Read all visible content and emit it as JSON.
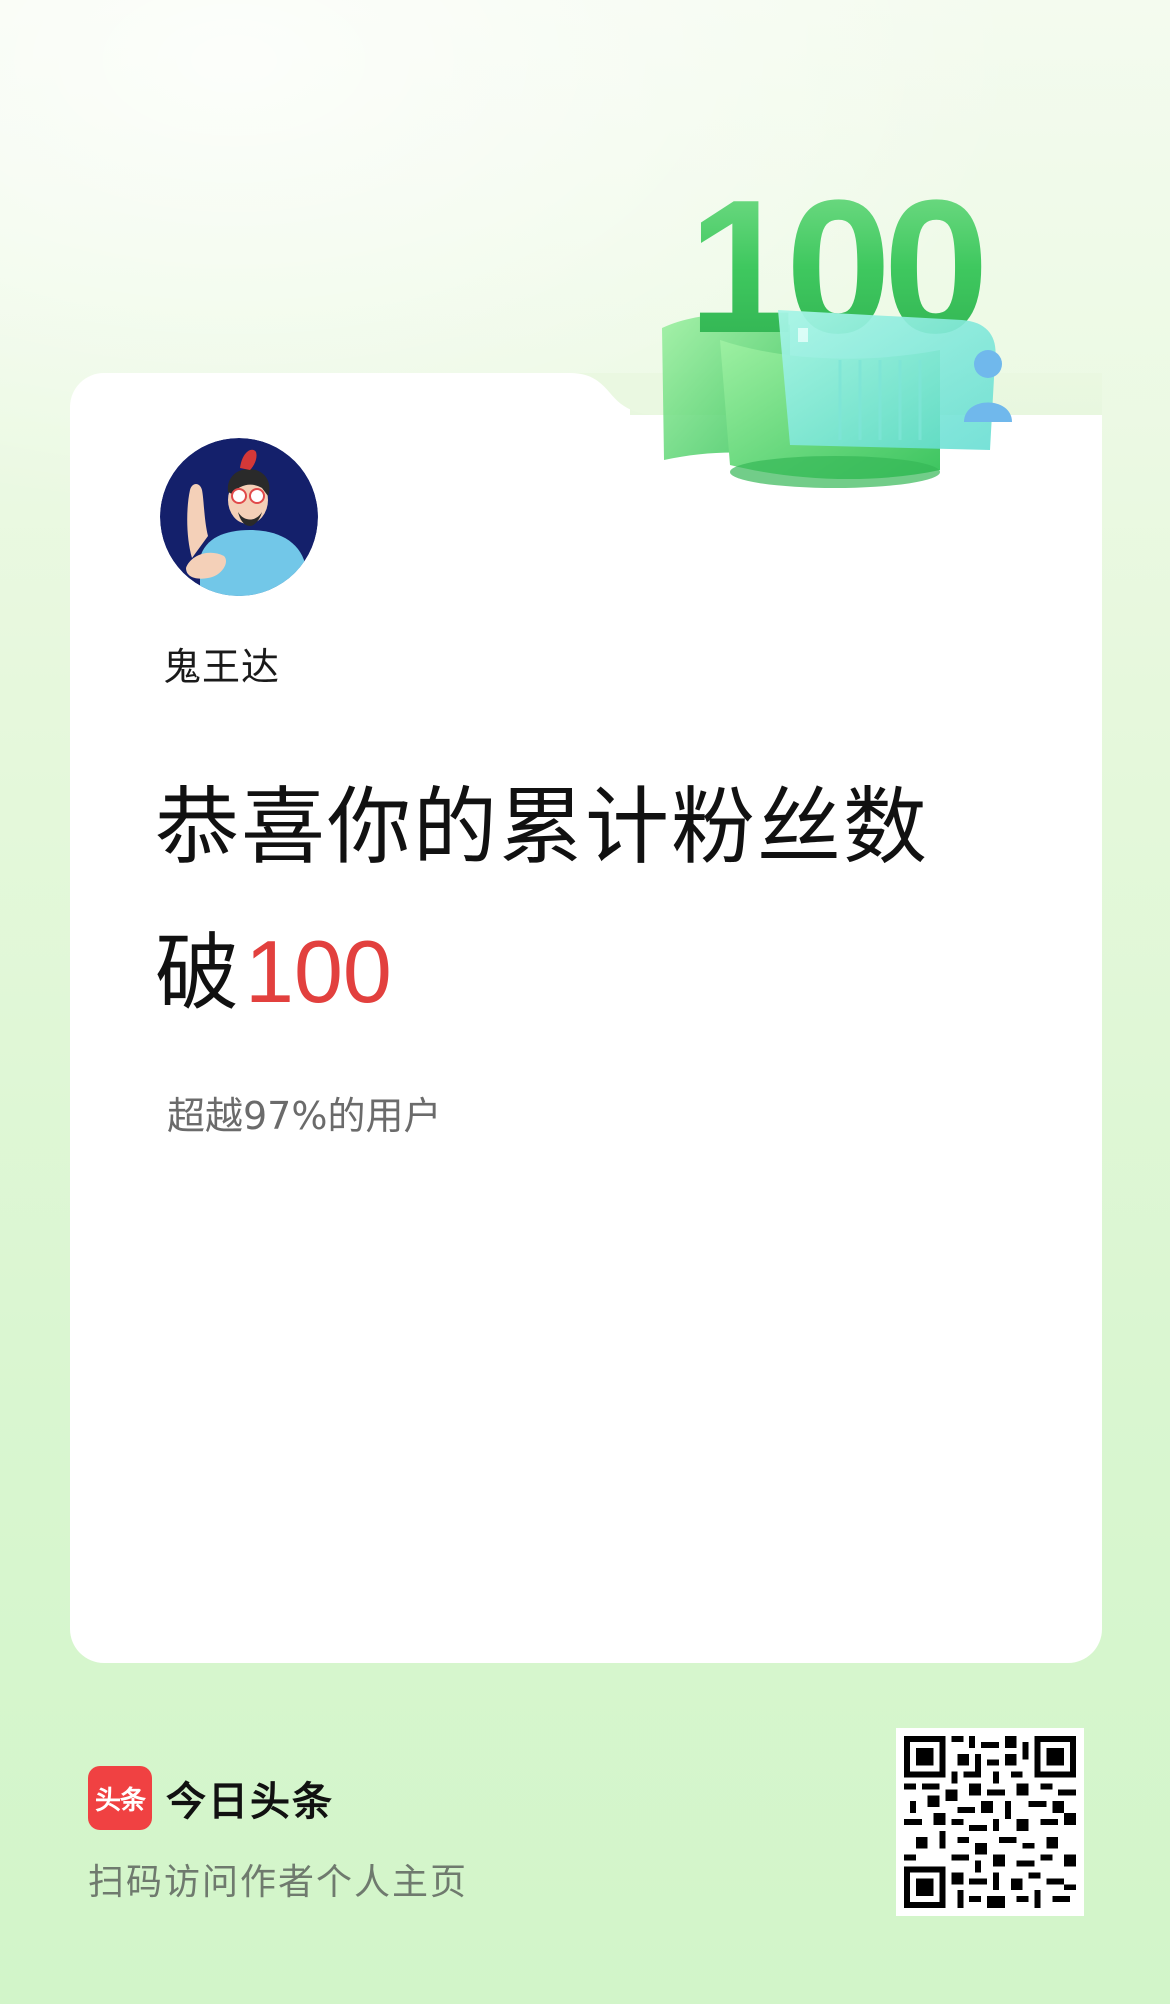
{
  "user": {
    "name": "鬼王达"
  },
  "milestone": {
    "headline_line1": "恭喜你的累计粉丝数",
    "headline_prefix": "破",
    "count": "100",
    "badge_number": "100",
    "surpass_text": "超越97%的用户"
  },
  "footer": {
    "logo_text": "头条",
    "app_name": "今日头条",
    "scan_hint": "扫码访问作者个人主页"
  },
  "colors": {
    "accent_red": "#e2403e",
    "brand_red": "#f04142",
    "badge_green": "#4ccf6b"
  },
  "icons": {
    "avatar": "cartoon-avatar",
    "trophy": "milestone-100-badge",
    "qr": "qr-code"
  }
}
